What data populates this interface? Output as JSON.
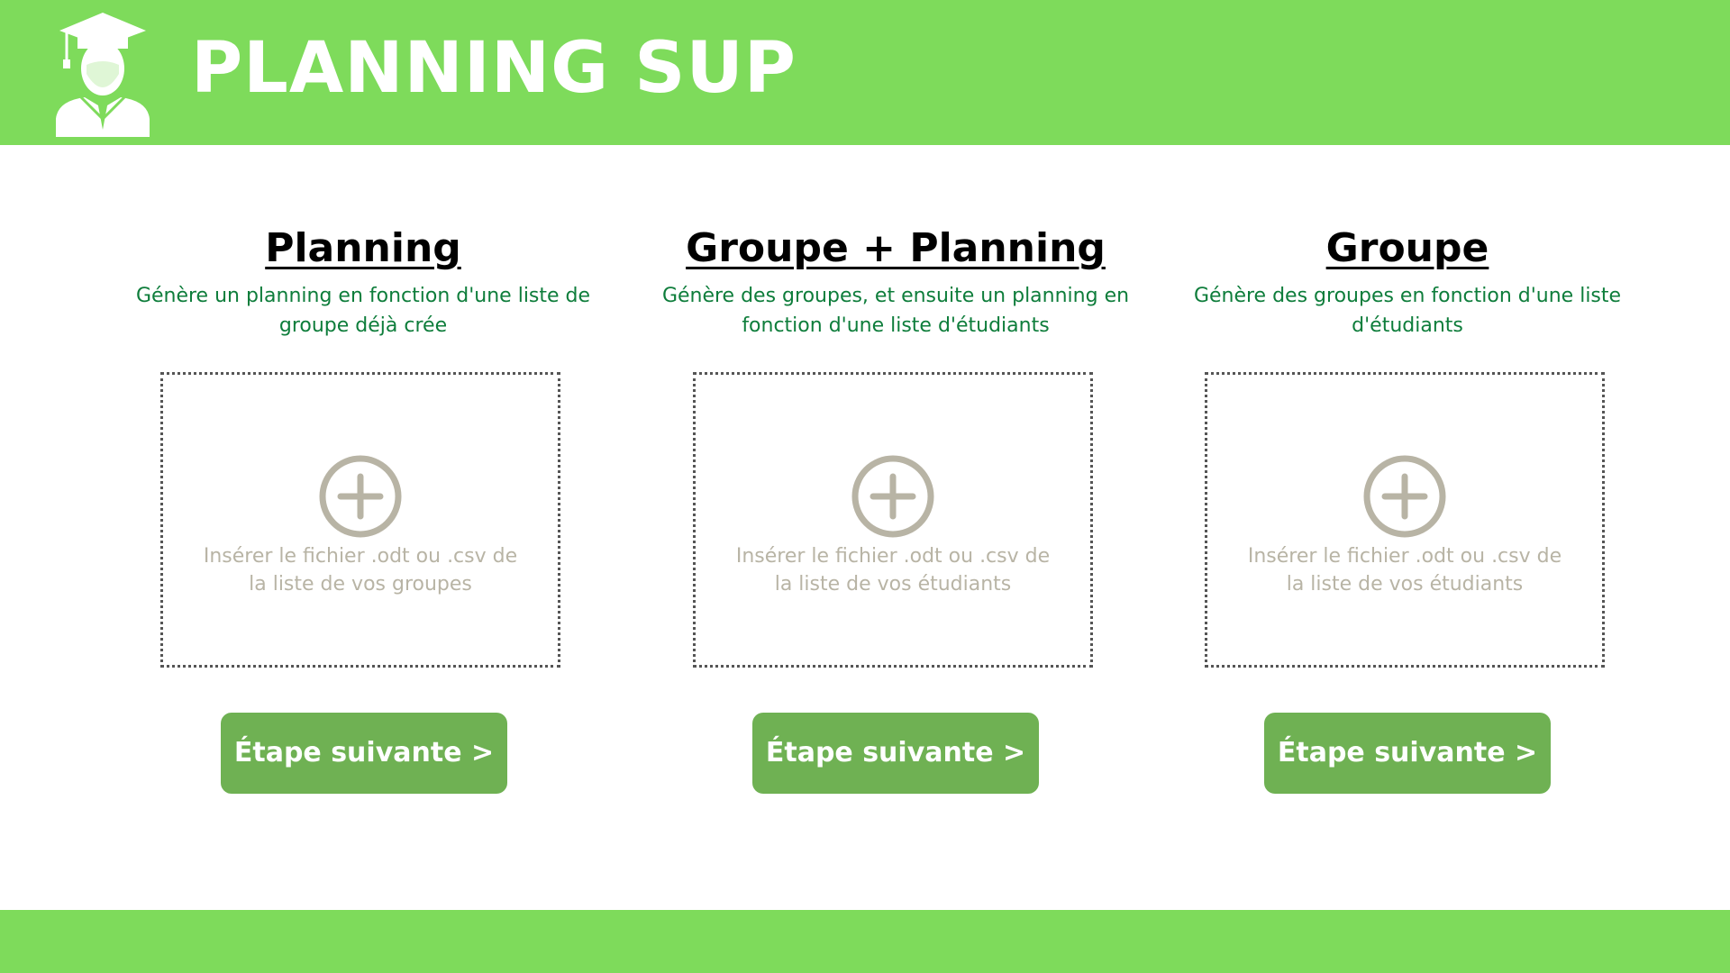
{
  "header": {
    "app_title": "PLANNING SUP",
    "logo_icon": "graduate-icon",
    "background_color": "#7edb5b"
  },
  "columns": [
    {
      "title": "Planning",
      "description": "Génère un planning en fonction d'une liste de groupe déjà crée",
      "dropzone_text": "Insérer le fichier .odt ou .csv de la liste de vos groupes",
      "dropzone_icon": "plus-circle-icon",
      "button_label": "Étape suivante >"
    },
    {
      "title": "Groupe + Planning",
      "description": "Génère des groupes, et ensuite un planning en fonction d'une liste d'étudiants",
      "dropzone_text": "Insérer le fichier .odt ou .csv de la liste de vos étudiants",
      "dropzone_icon": "plus-circle-icon",
      "button_label": "Étape suivante >"
    },
    {
      "title": "Groupe",
      "description": "Génère des groupes en fonction d'une liste d'étudiants",
      "dropzone_text": "Insérer le fichier .odt ou .csv de la liste de vos étudiants",
      "dropzone_icon": "plus-circle-icon",
      "button_label": "Étape suivante >"
    }
  ],
  "colors": {
    "accent_green": "#7edb5b",
    "button_green": "#6fb153",
    "description_green": "#0e7d3b",
    "dropzone_text": "#b8b4a5"
  }
}
